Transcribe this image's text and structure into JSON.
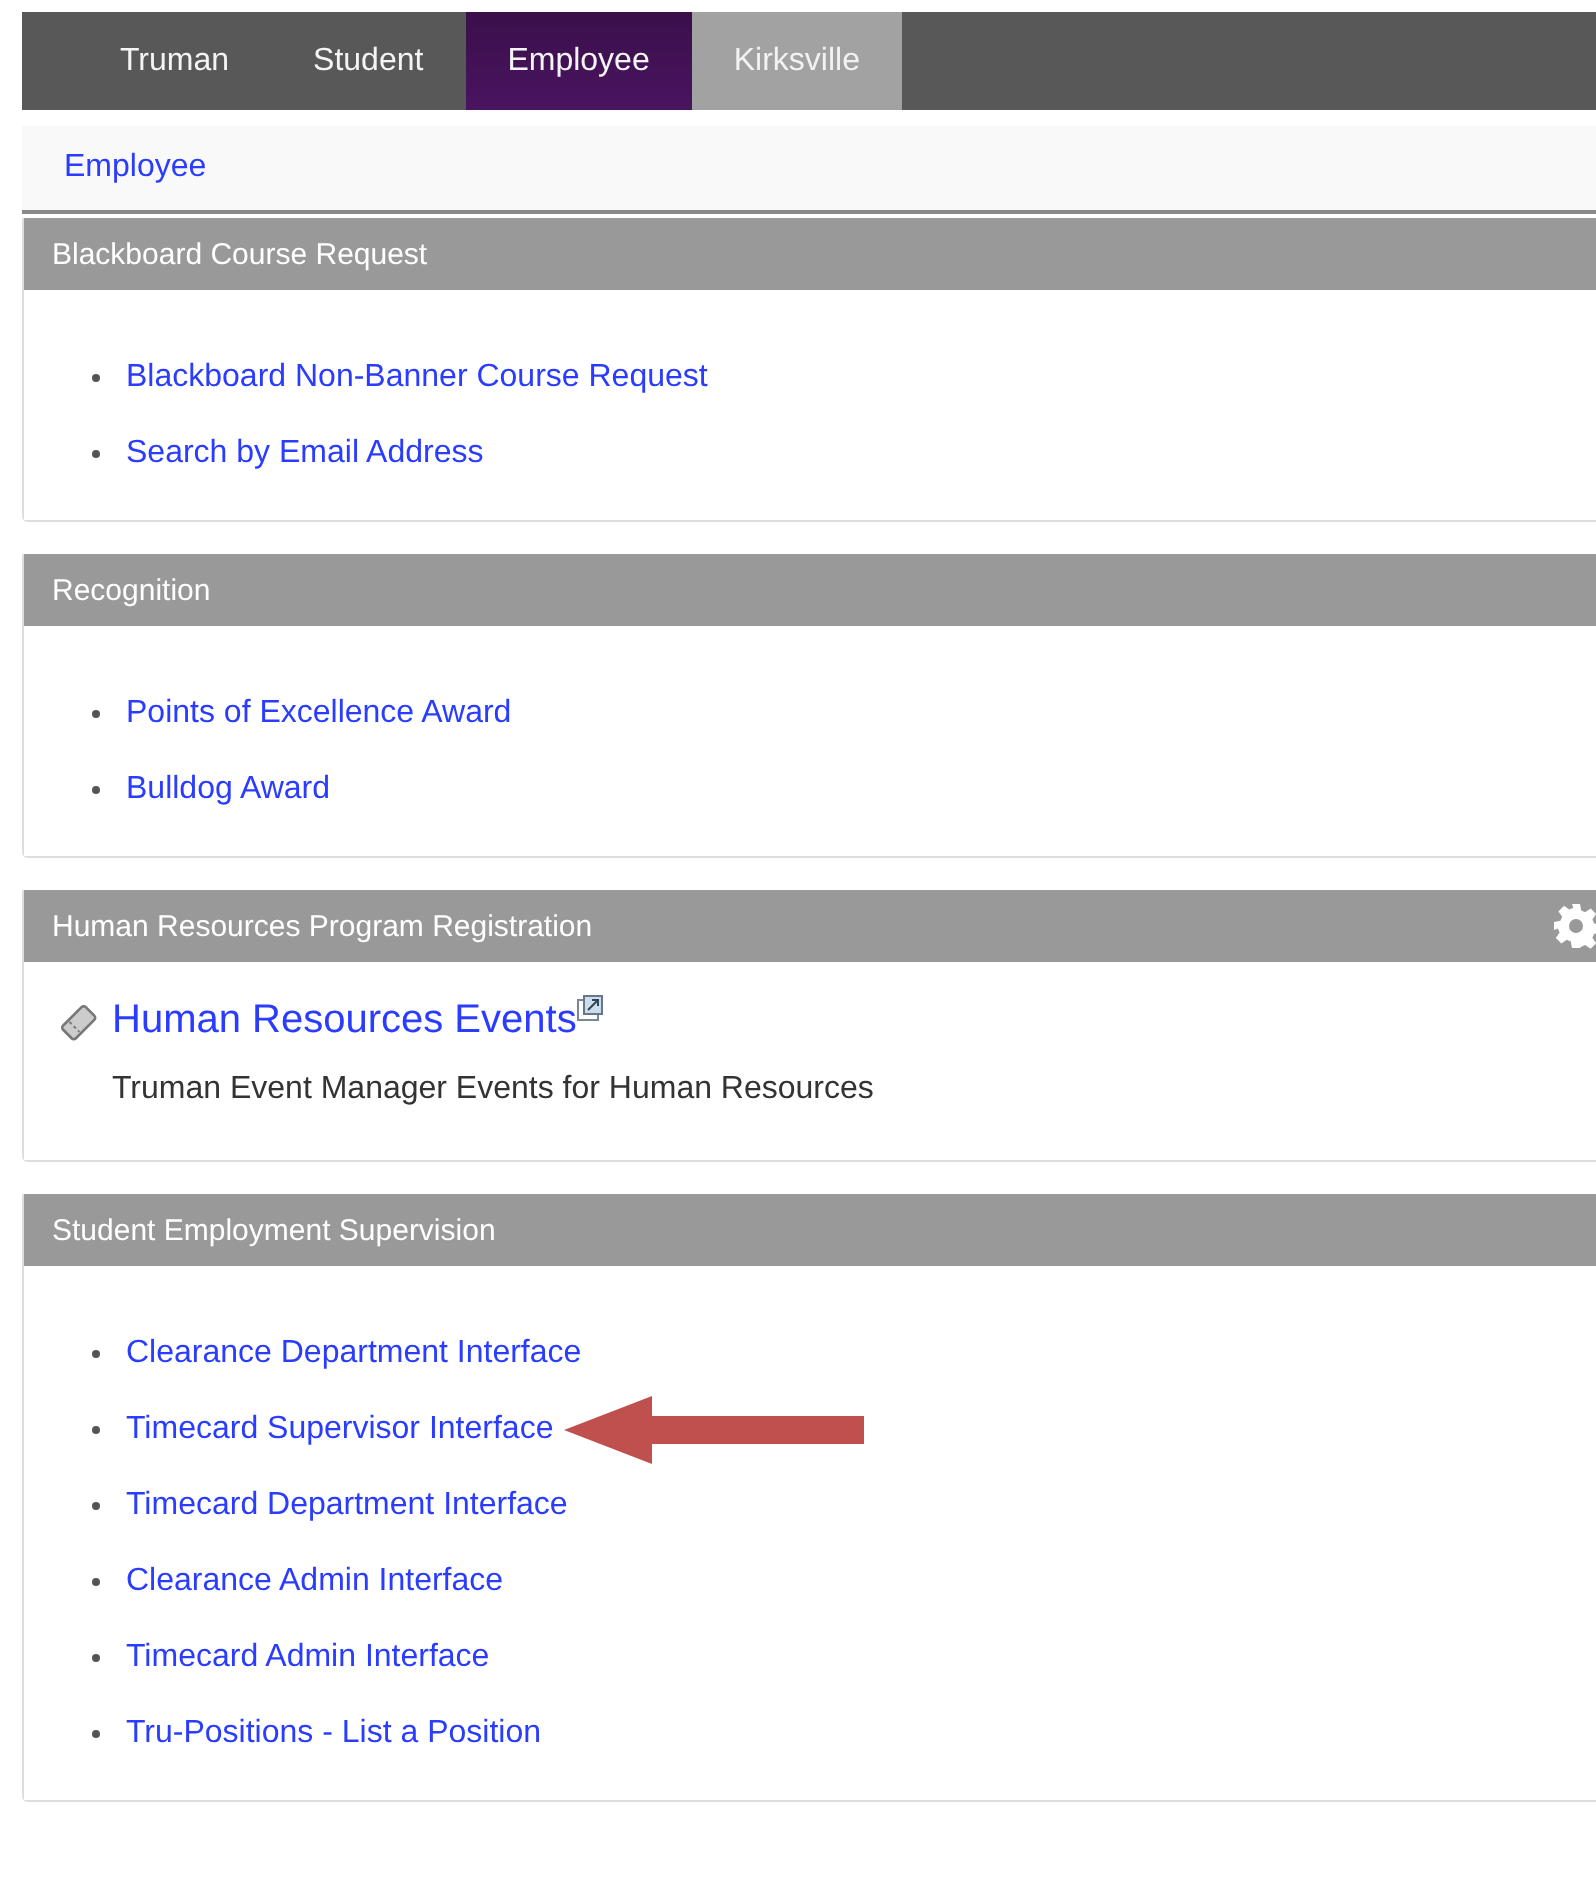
{
  "tabs": [
    {
      "label": "Truman",
      "selected": false,
      "kind": "dark"
    },
    {
      "label": "Student",
      "selected": false,
      "kind": "dark"
    },
    {
      "label": "Employee",
      "selected": true,
      "kind": "dark"
    },
    {
      "label": "Kirksville",
      "selected": false,
      "kind": "light"
    }
  ],
  "breadcrumb": "Employee",
  "panels": [
    {
      "title": "Blackboard Course Request",
      "kind": "links",
      "settings": false,
      "links": [
        {
          "label": "Blackboard Non-Banner Course Request",
          "arrow": false
        },
        {
          "label": "Search by Email Address",
          "arrow": false
        }
      ]
    },
    {
      "title": "Recognition",
      "kind": "links",
      "settings": false,
      "links": [
        {
          "label": "Points of Excellence Award",
          "arrow": false
        },
        {
          "label": "Bulldog Award",
          "arrow": false
        }
      ]
    },
    {
      "title": "Human Resources Program Registration",
      "kind": "event",
      "settings": true,
      "event": {
        "label": "Human Resources Events",
        "description": "Truman Event Manager Events for Human Resources"
      }
    },
    {
      "title": "Student Employment Supervision",
      "kind": "links",
      "settings": false,
      "links": [
        {
          "label": "Clearance Department Interface",
          "arrow": false
        },
        {
          "label": "Timecard Supervisor Interface",
          "arrow": true
        },
        {
          "label": "Timecard Department Interface",
          "arrow": false
        },
        {
          "label": "Clearance Admin Interface",
          "arrow": false
        },
        {
          "label": "Timecard Admin Interface",
          "arrow": false
        },
        {
          "label": "Tru-Positions - List a Position",
          "arrow": false
        }
      ]
    }
  ]
}
